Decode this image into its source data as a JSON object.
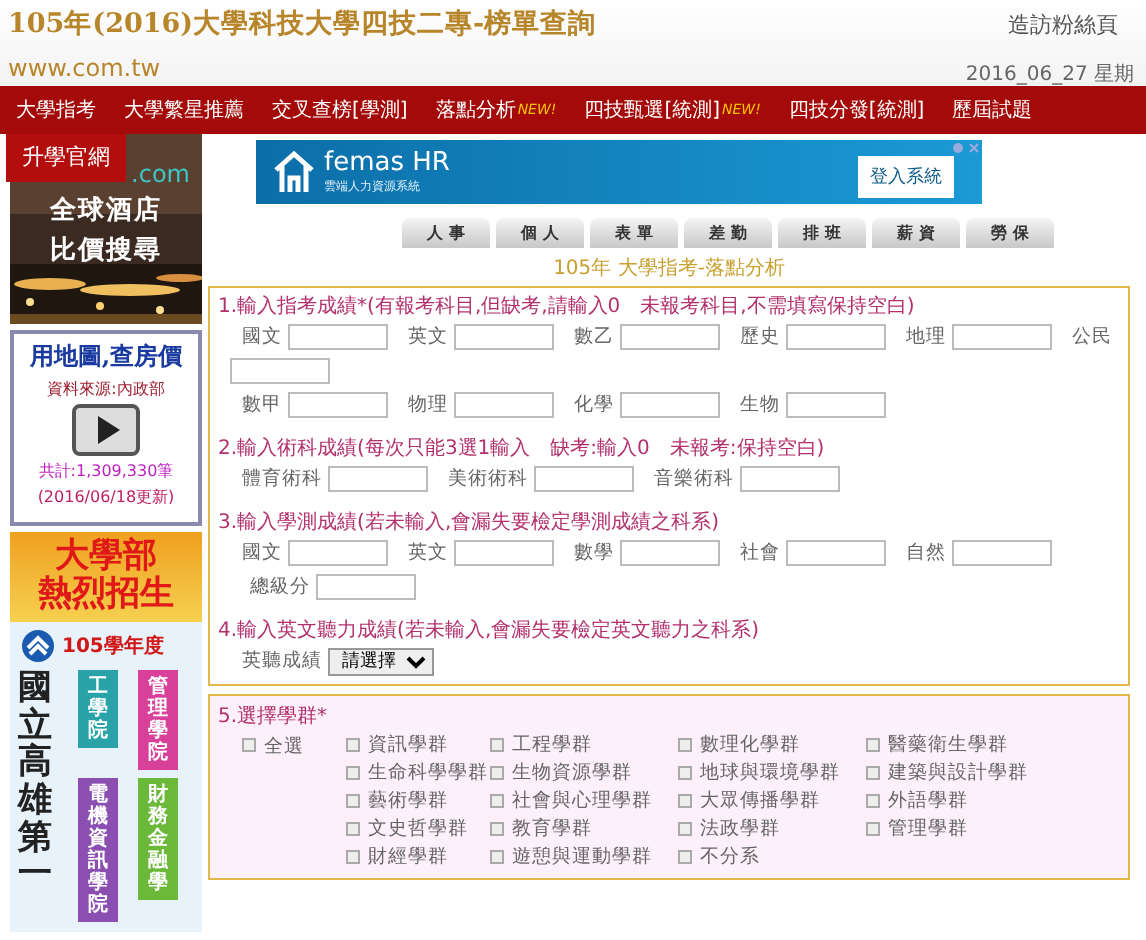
{
  "header": {
    "title": "105年(2016)大學科技大學四技二專-榜單查詢",
    "site": "www.com.tw",
    "fan_page_link": "造訪粉絲頁",
    "date": "2016_06_27 星期"
  },
  "nav": {
    "items": [
      {
        "label": "大學指考"
      },
      {
        "label": "大學繁星推薦"
      },
      {
        "label": "交叉查榜[學測]"
      },
      {
        "label": "落點分析",
        "badge": "NEW!"
      },
      {
        "label": "四技甄選[統測]",
        "badge": "NEW!"
      },
      {
        "label": "四技分發[統測]"
      },
      {
        "label": "歷屆試題"
      }
    ],
    "dropdown_item": "升學官網"
  },
  "hotel_ad": {
    "logo": ".com",
    "lines": [
      "全球酒店",
      "比價搜尋"
    ]
  },
  "map_ad": {
    "title": "用地圖,查房價",
    "source": "資料來源:內政部",
    "count": "共計:1,309,330筆",
    "updated": "(2016/06/18更新)"
  },
  "school_ad": {
    "headline": [
      "大學部",
      "熱烈招生"
    ],
    "year": "105學年度",
    "school": "國立高雄第一",
    "colleges": [
      {
        "label": "工學院",
        "color": "#2aa3a8"
      },
      {
        "label": "管理學院",
        "color": "#d8409a"
      },
      {
        "label": "電機資訊學院",
        "color": "#8a4fb0"
      },
      {
        "label": "財務金融學",
        "color": "#6cb83a"
      }
    ]
  },
  "banner": {
    "brand": "femas HR",
    "tagline": "雲端人力資源系統",
    "button": "登入系統"
  },
  "tabs": [
    {
      "label": "人 事"
    },
    {
      "label": "個 人"
    },
    {
      "label": "表 單"
    },
    {
      "label": "差 勤"
    },
    {
      "label": "排 班"
    },
    {
      "label": "薪 資"
    },
    {
      "label": "勞 保"
    }
  ],
  "page_title": "105年 大學指考-落點分析",
  "sections": [
    {
      "title": "1.輸入指考成績*(有報考科目,但缺考,請輸入0　未報考科目,不需填寫保持空白)",
      "rows": [
        [
          {
            "label": "國文",
            "kind": "input"
          },
          {
            "label": "英文",
            "kind": "input"
          },
          {
            "label": "數乙",
            "kind": "input"
          },
          {
            "label": "歷史",
            "kind": "input"
          },
          {
            "label": "地理",
            "kind": "input"
          },
          {
            "label": "公民",
            "kind": "input"
          }
        ],
        [
          {
            "label": "數甲",
            "kind": "input"
          },
          {
            "label": "物理",
            "kind": "input"
          },
          {
            "label": "化學",
            "kind": "input"
          },
          {
            "label": "生物",
            "kind": "input"
          }
        ]
      ]
    },
    {
      "title": "2.輸入術科成績(每次只能3選1輸入　缺考:輸入0　未報考:保持空白)",
      "rows": [
        [
          {
            "label": "體育術科",
            "kind": "input"
          },
          {
            "label": "美術術科",
            "kind": "input"
          },
          {
            "label": "音樂術科",
            "kind": "input"
          }
        ]
      ]
    },
    {
      "title": "3.輸入學測成績(若未輸入,會漏失要檢定學測成績之科系)",
      "rows": [
        [
          {
            "label": "國文",
            "kind": "input"
          },
          {
            "label": "英文",
            "kind": "input"
          },
          {
            "label": "數學",
            "kind": "input"
          },
          {
            "label": "社會",
            "kind": "input"
          },
          {
            "label": "自然",
            "kind": "input"
          },
          {
            "label": "總級分",
            "kind": "input"
          }
        ]
      ]
    },
    {
      "title": "4.輸入英文聽力成績(若未輸入,會漏失要檢定英文聽力之科系)",
      "rows": [
        [
          {
            "label": "英聽成績",
            "kind": "select",
            "value": "請選擇"
          }
        ]
      ]
    }
  ],
  "groups": {
    "title": "5.選擇學群*",
    "select_all": {
      "label": "全選",
      "checked": false
    },
    "items": [
      {
        "label": "資訊學群",
        "checked": false
      },
      {
        "label": "工程學群",
        "checked": false
      },
      {
        "label": "數理化學群",
        "checked": false
      },
      {
        "label": "醫藥衛生學群",
        "checked": false
      },
      {
        "label": "生命科學學群",
        "checked": false
      },
      {
        "label": "生物資源學群",
        "checked": false
      },
      {
        "label": "地球與環境學群",
        "checked": false
      },
      {
        "label": "建築與設計學群",
        "checked": false
      },
      {
        "label": "藝術學群",
        "checked": false
      },
      {
        "label": "社會與心理學群",
        "checked": false
      },
      {
        "label": "大眾傳播學群",
        "checked": false
      },
      {
        "label": "外語學群",
        "checked": false
      },
      {
        "label": "文史哲學群",
        "checked": false
      },
      {
        "label": "教育學群",
        "checked": false
      },
      {
        "label": "法政學群",
        "checked": false
      },
      {
        "label": "管理學群",
        "checked": false
      },
      {
        "label": "財經學群",
        "checked": false
      },
      {
        "label": "遊憩與運動學群",
        "checked": false
      },
      {
        "label": "不分系",
        "checked": false
      }
    ]
  }
}
